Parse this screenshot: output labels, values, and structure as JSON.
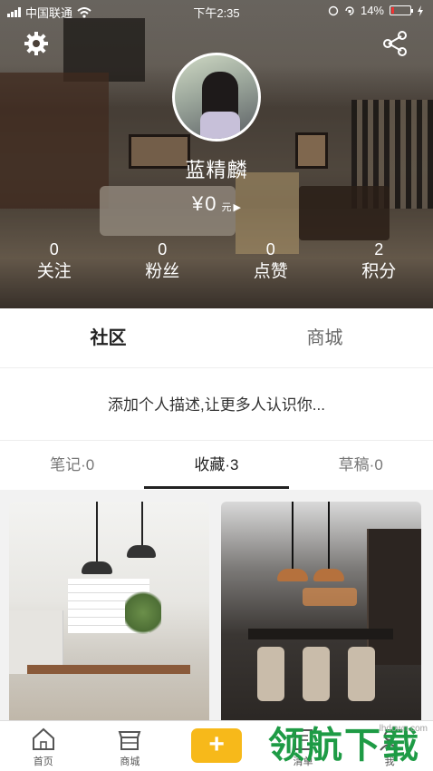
{
  "status_bar": {
    "carrier": "中国联通",
    "time": "下午2:35",
    "battery": "14%",
    "battery_level": 0.14
  },
  "profile": {
    "username": "蓝精麟",
    "balance_currency": "¥",
    "balance_value": "0",
    "balance_unit": "元",
    "stats": [
      {
        "value": "0",
        "label": "关注"
      },
      {
        "value": "0",
        "label": "粉丝"
      },
      {
        "value": "0",
        "label": "点赞"
      },
      {
        "value": "2",
        "label": "积分"
      }
    ]
  },
  "main_tabs": [
    {
      "label": "社区",
      "active": true
    },
    {
      "label": "商城",
      "active": false
    }
  ],
  "description_prompt": "添加个人描述,让更多人认识你...",
  "sub_tabs": [
    {
      "label": "笔记·0",
      "active": false
    },
    {
      "label": "收藏·3",
      "active": true
    },
    {
      "label": "草稿·0",
      "active": false
    }
  ],
  "tab_bar": {
    "items": [
      {
        "label": "首页",
        "icon": "home-icon"
      },
      {
        "label": "商城",
        "icon": "store-icon"
      },
      {
        "label": "",
        "icon": "plus-icon"
      },
      {
        "label": "清单",
        "icon": "list-icon"
      },
      {
        "label": "我",
        "icon": "me-icon"
      }
    ],
    "add_symbol": "+",
    "accent": "#f7b91a"
  },
  "watermark": {
    "text": "领航下载",
    "url": "lhdown.com"
  }
}
